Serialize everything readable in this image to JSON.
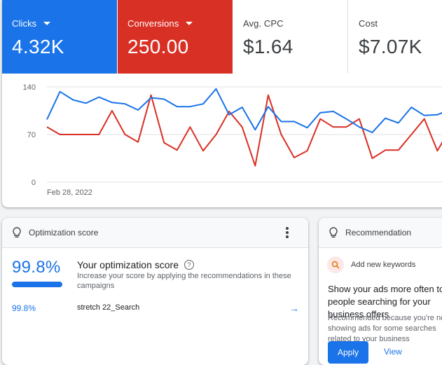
{
  "metrics": {
    "clicks": {
      "label": "Clicks",
      "value": "4.32K"
    },
    "conversions": {
      "label": "Conversions",
      "value": "250.00"
    },
    "avg_cpc": {
      "label": "Avg. CPC",
      "value": "$1.64"
    },
    "cost": {
      "label": "Cost",
      "value": "$7.07K"
    }
  },
  "colors": {
    "clicks": "#1a73e8",
    "conversions": "#d93025"
  },
  "chart_data": {
    "type": "line",
    "y_ticks": [
      "140",
      "70",
      "0"
    ],
    "ylim": [
      0,
      140
    ],
    "x_label_first": "Feb 28, 2022",
    "grid": true,
    "series": [
      {
        "color": "#1a73e8",
        "values": [
          92,
          133,
          121,
          116,
          125,
          117,
          115,
          106,
          124,
          122,
          111,
          111,
          115,
          137,
          99,
          110,
          77,
          111,
          89,
          89,
          80,
          102,
          104,
          93,
          81,
          73,
          94,
          87,
          110,
          98,
          99,
          107
        ]
      },
      {
        "color": "#d93025",
        "values": [
          81,
          70,
          70,
          70,
          70,
          105,
          70,
          59,
          128,
          58,
          47,
          81,
          46,
          70,
          104,
          81,
          24,
          128,
          70,
          36,
          46,
          93,
          81,
          81,
          93,
          35,
          47,
          47,
          70,
          93,
          46,
          79
        ]
      }
    ]
  },
  "optimization": {
    "header": "Optimization score",
    "score": "99.8%",
    "score_fraction": 0.998,
    "title": "Your optimization score",
    "description": "Increase your score by applying the recommendations in these campaigns",
    "campaign_score": "99.8%",
    "campaign_name": "stretch 22_Search"
  },
  "recommendation": {
    "header": "Recommendation",
    "item": "Add new keywords",
    "headline": "Show your ads more often to people searching for your business offers",
    "reason": "Recommended because you're not showing ads for some searches related to your business",
    "apply": "Apply",
    "view": "View"
  }
}
